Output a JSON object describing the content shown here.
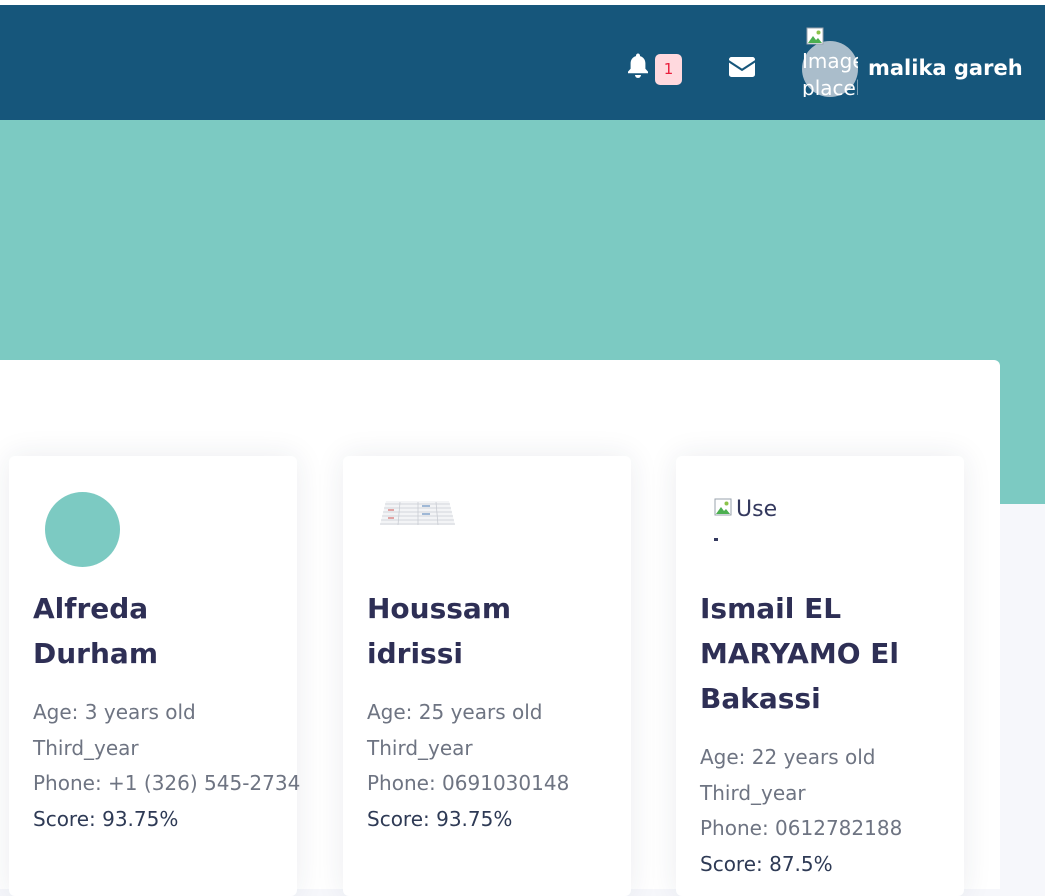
{
  "header": {
    "notification_count": "1",
    "avatar_alt": "Image placeholder",
    "user_name": "malika gareh"
  },
  "students": [
    {
      "name": "Alfreda Durham",
      "age": "Age: 3 years old",
      "year": "Third_year",
      "phone": "Phone: +1 (326) 545-2734",
      "score": "Score: 93.75%",
      "photo": "teal-circle"
    },
    {
      "name": "Houssam idrissi",
      "age": "Age: 25 years old",
      "year": "Third_year",
      "phone": "Phone: 0691030148",
      "score": "Score: 93.75%",
      "photo": "table-thumbnail"
    },
    {
      "name": "Ismail EL MARYAMO El Bakassi",
      "age": "Age: 22 years old",
      "year": "Third_year",
      "phone": "Phone: 0612782188",
      "score": "Score: 87.5%",
      "photo": "broken-image",
      "photo_alt": "Use"
    }
  ],
  "colors": {
    "header": "#16567b",
    "hero": "#7ccac2",
    "badge_bg": "#ffd9de",
    "badge_text": "#ea1f3d",
    "name_text": "#2e2f55"
  },
  "icons": [
    "bell-icon",
    "envelope-icon",
    "broken-image-icon"
  ]
}
